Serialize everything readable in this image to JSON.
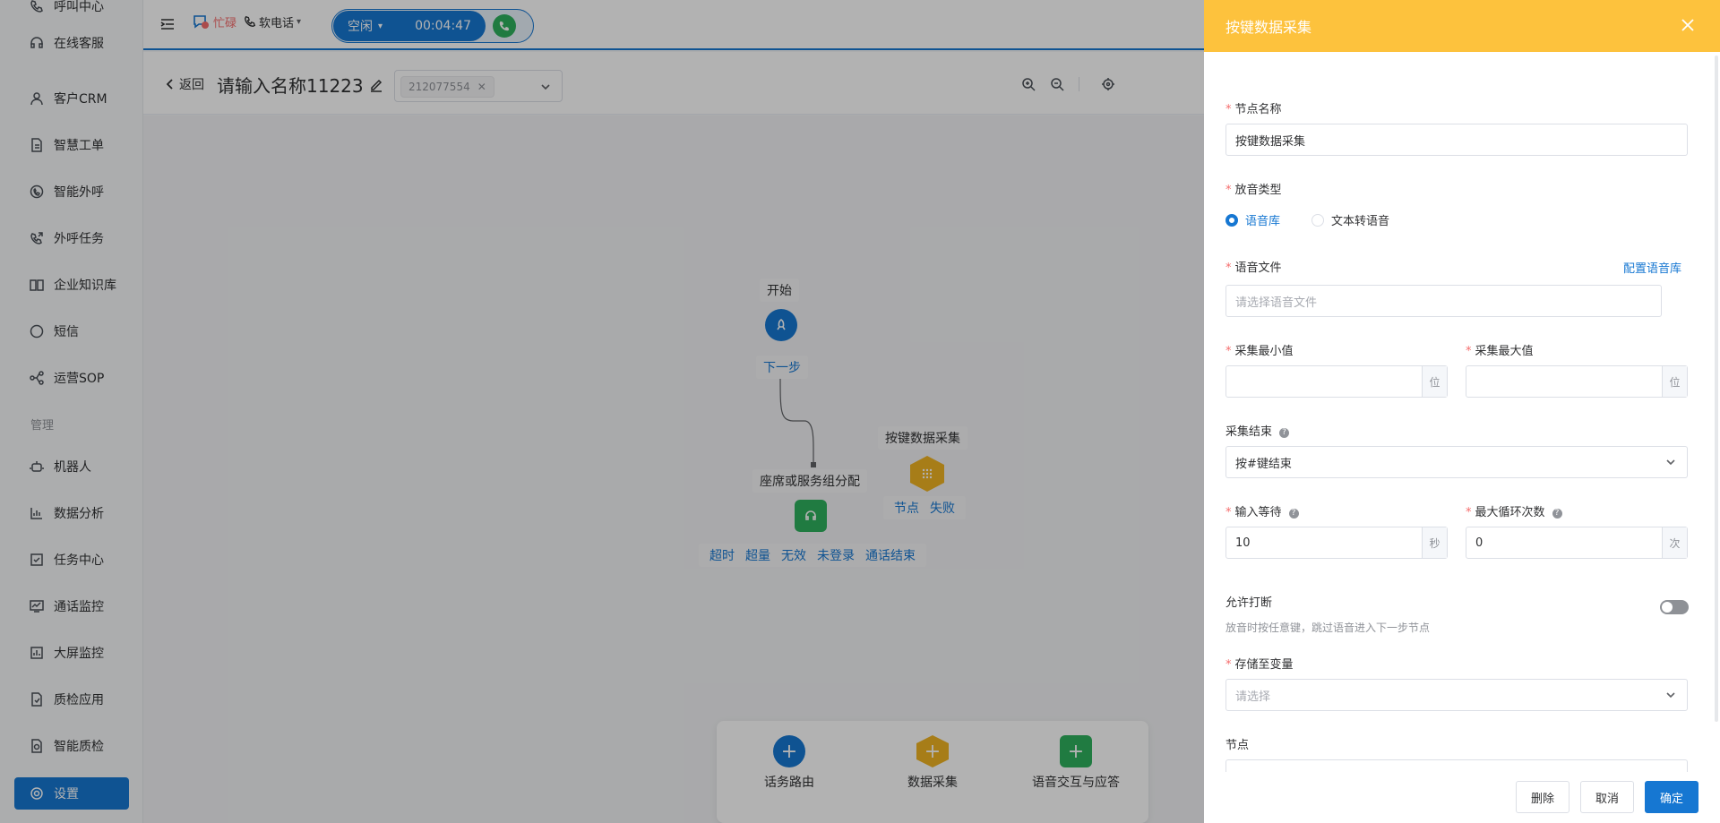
{
  "sidebar": {
    "items": [
      {
        "label": "呼叫中心",
        "icon": "phone-icon"
      },
      {
        "label": "在线客服",
        "icon": "headset-icon"
      },
      {
        "label": "客户CRM",
        "icon": "user-icon"
      },
      {
        "label": "智慧工单",
        "icon": "document-icon"
      },
      {
        "label": "智能外呼",
        "icon": "chat-phone-icon"
      },
      {
        "label": "外呼任务",
        "icon": "outbound-icon"
      },
      {
        "label": "企业知识库",
        "icon": "book-icon"
      },
      {
        "label": "短信",
        "icon": "sms-icon"
      },
      {
        "label": "运营SOP",
        "icon": "flow-icon"
      }
    ],
    "section_label": "管理",
    "manage_items": [
      {
        "label": "机器人",
        "icon": "robot-icon"
      },
      {
        "label": "数据分析",
        "icon": "bar-chart-icon"
      },
      {
        "label": "任务中心",
        "icon": "task-icon"
      },
      {
        "label": "通话监控",
        "icon": "monitor-icon"
      },
      {
        "label": "大屏监控",
        "icon": "screen-icon"
      },
      {
        "label": "质检应用",
        "icon": "quality-icon"
      },
      {
        "label": "智能质检",
        "icon": "smart-quality-icon"
      },
      {
        "label": "设置",
        "icon": "gear-icon"
      }
    ]
  },
  "header": {
    "busy_status": "忙碌",
    "softphone": "软电话",
    "call_state": "空闲",
    "call_timer": "00:04:47"
  },
  "subbar": {
    "back": "返回",
    "title": "请输入名称11223",
    "tag": "212077554"
  },
  "canvas": {
    "start_label": "开始",
    "next_step": "下一步",
    "assign_label": "座席或服务组分配",
    "assign_branches": [
      "超时",
      "超量",
      "无效",
      "未登录",
      "通话结束"
    ],
    "collect_label": "按键数据采集",
    "collect_branches": [
      "节点",
      "失败"
    ],
    "tools": [
      {
        "label": "话务路由",
        "color": "#1677d2"
      },
      {
        "label": "数据采集",
        "color": "#f0b323"
      },
      {
        "label": "语音交互与应答",
        "color": "#2fb05e"
      }
    ]
  },
  "drawer": {
    "title": "按键数据采集",
    "node_name_label": "节点名称",
    "node_name_value": "按键数据采集",
    "play_type_label": "放音类型",
    "play_options": [
      "语音库",
      "文本转语音"
    ],
    "voice_file_label": "语音文件",
    "voice_config_link": "配置语音库",
    "voice_file_placeholder": "请选择语音文件",
    "min_label": "采集最小值",
    "max_label": "采集最大值",
    "digit_unit": "位",
    "end_label": "采集结束",
    "end_value": "按#键结束",
    "wait_label": "输入等待",
    "wait_value": "10",
    "wait_unit": "秒",
    "loop_label": "最大循环次数",
    "loop_value": "0",
    "loop_unit": "次",
    "interrupt_label": "允许打断",
    "interrupt_hint": "放音时按任意键，跳过语音进入下一步节点",
    "store_label": "存储至变量",
    "store_placeholder": "请选择",
    "node_label": "节点",
    "buttons": {
      "delete": "删除",
      "cancel": "取消",
      "ok": "确定"
    }
  }
}
